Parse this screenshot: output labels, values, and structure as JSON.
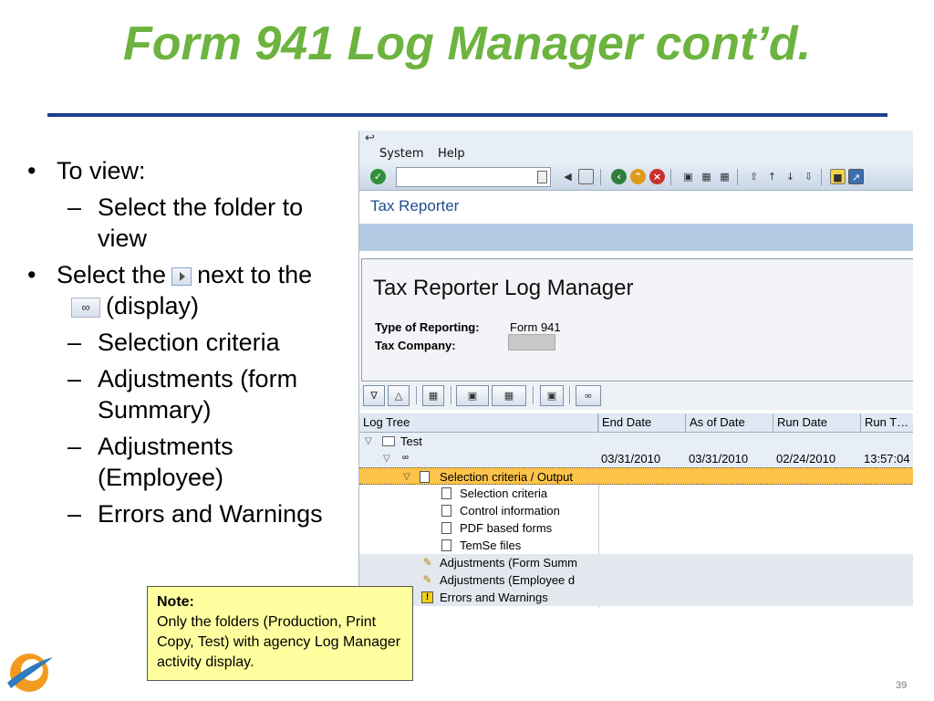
{
  "slide": {
    "title": "Form 941 Log Manager cont’d.",
    "page_number": "39"
  },
  "bullets": {
    "b1": "To view:",
    "b1_sub1": "Select the folder to view",
    "b2_pre": "Select the",
    "b2_mid": "next to the",
    "b2_post": "(display)",
    "b2_sub1": "Selection criteria",
    "b2_sub2": "Adjustments (form Summary)",
    "b2_sub3": "Adjustments (Employee)",
    "b2_sub4": "Errors and Warnings"
  },
  "note": {
    "title": "Note:",
    "body": "Only the folders (Production, Print Copy, Test) with agency Log Manager activity display."
  },
  "sap": {
    "menu": [
      "System",
      "Help"
    ],
    "command_field": "",
    "app_title": "Tax Reporter",
    "panel_title": "Tax Reporter Log Manager",
    "type_label": "Type of Reporting:",
    "type_value": "Form 941",
    "company_label": "Tax Company:",
    "company_value": "",
    "tree": {
      "columns": [
        "Log Tree",
        "End Date",
        "As of Date",
        "Run Date",
        "Run T…"
      ],
      "rows": {
        "test": "Test",
        "run": {
          "end": "03/31/2010",
          "asof": "03/31/2010",
          "rundate": "02/24/2010",
          "runtime": "13:57:04"
        },
        "sel_output": "Selection criteria / Output",
        "sel_criteria": "Selection criteria",
        "control_info": "Control information",
        "pdf_forms": "PDF based forms",
        "temse": "TemSe files",
        "adj_form": "Adjustments (Form Summ",
        "adj_emp": "Adjustments (Employee d",
        "errors": "Errors and Warnings"
      }
    }
  },
  "colors": {
    "title_green": "#6db33f",
    "rule_blue": "#1e3f8f",
    "note_yellow": "#ffffa0",
    "selected_row": "#fdc34a",
    "sap_blue_band": "#b4cbe6"
  }
}
